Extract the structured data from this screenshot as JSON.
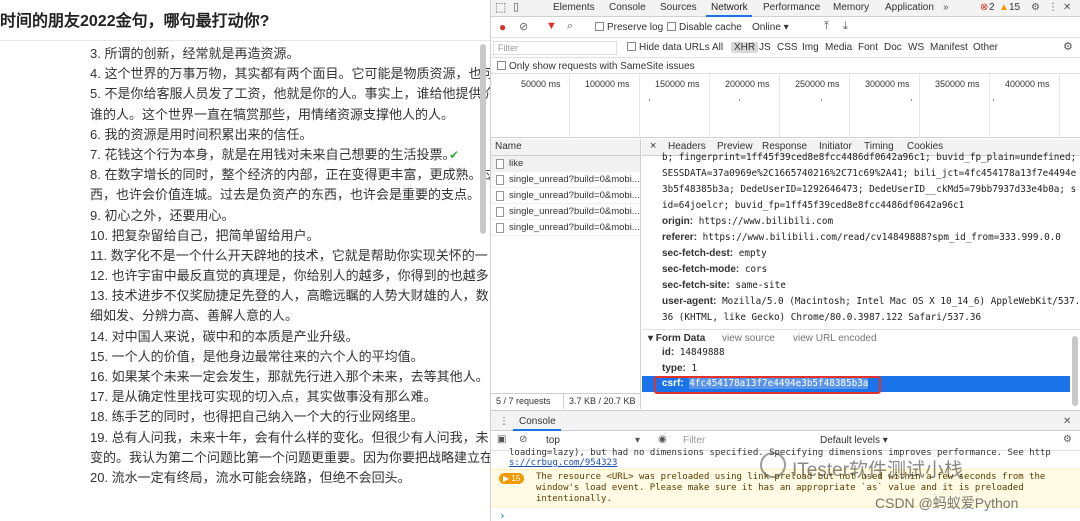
{
  "article": {
    "title": "时间的朋友2022金句，哪句最打动你?",
    "lines": [
      "3. 所谓的创新，经常就是再造资源。",
      "4. 这个世界的万事万物，其实都有两个面目。它可能是物质资源，也可",
      "5. 不是你给客服人员发了工资，他就是你的人。事实上，谁给他提供价",
      "谁的人。这个世界一直在犒赏那些，用情绪资源支撑他人的人。",
      "6. 我的资源是用时间积累出来的信任。",
      "7. 花钱这个行为本身，就是在用钱对未来自己想要的生活投票。",
      "8. 在数字增长的同时，整个经济的内部，正在变得更丰富，更成熟。过",
      "西，也许会价值连城。过去是负资产的东西，也许会是重要的支点。",
      "9. 初心之外，还要用心。",
      "10. 把复杂留给自己，把简单留给用户。",
      "11. 数字化不是一个什么开天辟地的技术，它就是帮助你实现关怀的一",
      "12. 也许宇宙中最反直觉的真理是，你给别人的越多，你得到的也越多",
      "13. 技术进步不仅奖励捷足先登的人，高瞻远瞩的人势大财雄的人，数",
      "细如发、分辨力高、善解人意的人。",
      "14. 对中国人来说，碳中和的本质是产业升级。",
      "15. 一个人的价值，是他身边最常往来的六个人的平均值。",
      "16. 如果某个未来一定会发生，那就先行进入那个未来，去等其他人。",
      "17. 是从确定性里找可实现的切入点，其实做事没有那么难。",
      "18. 练手艺的同时，也得把自己纳入一个大的行业网络里。",
      "19. 总有人问我，未来十年，会有什么样的变化。但很少有人问我，未",
      "变的。我认为第二个问题比第一个问题更重要。因为你要把战略建立在",
      "20. 流水一定有终局，流水可能会绕路，但绝不会回头。"
    ]
  },
  "devtools": {
    "tabs": [
      "Elements",
      "Console",
      "Sources",
      "Network",
      "Performance",
      "Memory",
      "Application"
    ],
    "active_tab": "Network",
    "error_count": "2",
    "warn_count": "15",
    "toolbar": {
      "preserve_log": "Preserve log",
      "disable_cache": "Disable cache",
      "throttle": "Online"
    },
    "filter": {
      "placeholder": "Filter",
      "hide_data_urls": "Hide data URLs",
      "types": [
        "All",
        "XHR",
        "JS",
        "CSS",
        "Img",
        "Media",
        "Font",
        "Doc",
        "WS",
        "Manifest",
        "Other"
      ],
      "samesite": "Only show requests with SameSite issues"
    },
    "timeline_ticks": [
      "50000 ms",
      "100000 ms",
      "150000 ms",
      "200000 ms",
      "250000 ms",
      "300000 ms",
      "350000 ms",
      "400000 ms"
    ],
    "request_list": {
      "header": "Name",
      "rows": [
        "like",
        "single_unread?build=0&mobi...",
        "single_unread?build=0&mobi...",
        "single_unread?build=0&mobi...",
        "single_unread?build=0&mobi..."
      ],
      "footer_requests": "5 / 7 requests",
      "footer_size": "3.7 KB / 20.7 KB"
    },
    "detail_tabs": [
      "Headers",
      "Preview",
      "Response",
      "Initiator",
      "Timing",
      "Cookies"
    ],
    "close_glyph": "×",
    "headers": {
      "cookie_lines": [
        "b; fingerprint=1ff45f39ced8e8fcc4486df0642a96c1; buvid_fp_plain=undefined;",
        "SESSDATA=37a0969e%2C1665740216%2C71c69%2A41; bili_jct=4fc454178a13f7e4494e",
        "3b5f48385b3a; DedeUserID=1292646473; DedeUserID__ckMd5=79bb7937d33e4b0a; s",
        "id=64joelcr; buvid_fp=1ff45f39ced8e8fcc4486df0642a96c1"
      ],
      "origin_key": "origin:",
      "origin_val": "https://www.bilibili.com",
      "referer_key": "referer:",
      "referer_val": "https://www.bilibili.com/read/cv14849888?spm_id_from=333.999.0.0",
      "dest_key": "sec-fetch-dest:",
      "dest_val": "empty",
      "mode_key": "sec-fetch-mode:",
      "mode_val": "cors",
      "site_key": "sec-fetch-site:",
      "site_val": "same-site",
      "ua_key": "user-agent:",
      "ua_val1": "Mozilla/5.0 (Macintosh; Intel Mac OS X 10_14_6) AppleWebKit/537.",
      "ua_val2": "36 (KHTML, like Gecko) Chrome/80.0.3987.122 Safari/537.36"
    },
    "form_data": {
      "title": "▾ Form Data",
      "view_source": "view source",
      "view_url_encoded": "view URL encoded",
      "id_key": "id:",
      "id_val": "14849888",
      "type_key": "type:",
      "type_val": "1",
      "csrf_key": "csrf:",
      "csrf_val": "4fc454178a13f7e4494e3b5f48385b3a"
    },
    "console": {
      "tab": "Console",
      "context": "top",
      "filter_placeholder": "Filter",
      "levels": "Default levels ▾",
      "line1": "loading=lazy), but had no dimensions specified. Specifying dimensions improves performance. See http",
      "line2": "s://crbug.com/954323",
      "warn_count": "15",
      "warn1": "The resource <URL> was preloaded using link preload but not used within a few seconds from the",
      "warn2": "window's load event. Please make sure it has an appropriate `as` value and it is preloaded",
      "warn3": "intentionally.",
      "prompt": "›"
    }
  },
  "watermark": {
    "main": "ITester软件测试小栈",
    "sub": "CSDN @蚂蚁爱Python"
  },
  "colors": {
    "accent": "#1a73e8",
    "error_red": "#d93025",
    "highlight_box": "#e0322b",
    "warn_bg": "#fffbe5"
  }
}
